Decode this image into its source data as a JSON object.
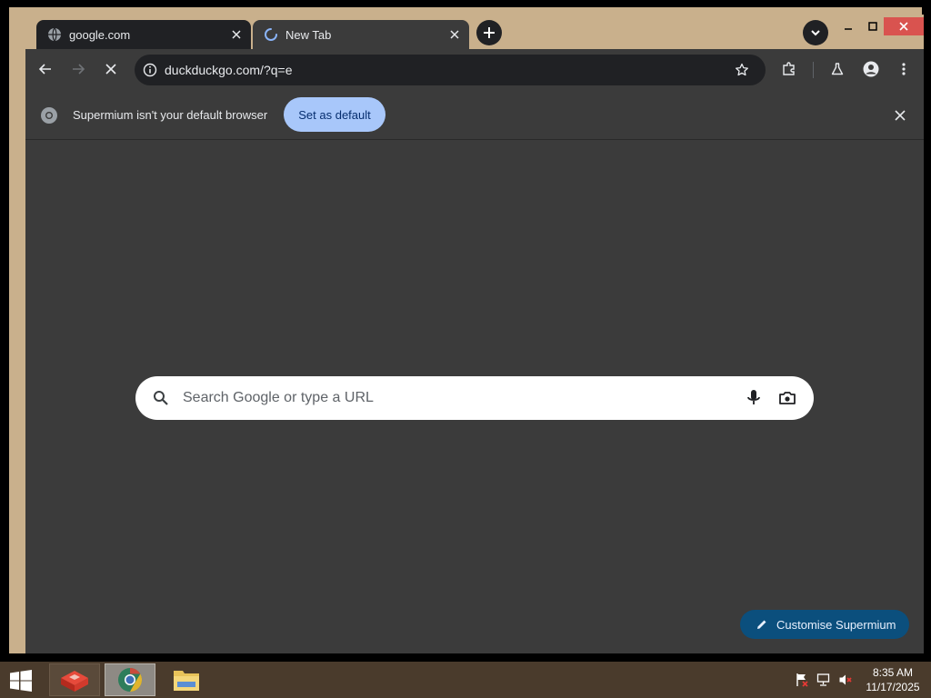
{
  "tabs": [
    {
      "title": "google.com",
      "favicon": "globe-icon"
    },
    {
      "title": "New Tab",
      "favicon": "loading-spinner-icon"
    }
  ],
  "toolbar": {
    "url": "duckduckgo.com/?q=e"
  },
  "infobar": {
    "message": "Supermium isn't your default browser",
    "button_label": "Set as default"
  },
  "search": {
    "placeholder": "Search Google or type a URL"
  },
  "customise": {
    "label": "Customise Supermium"
  },
  "taskbar": {
    "time": "8:35 AM",
    "date": "11/17/2025"
  },
  "colors": {
    "frame": "#c9b08c",
    "browser_bg": "#3b3b3b",
    "active_tab": "#202124",
    "set_default_button": "#a8c7fa",
    "customise_button": "#0b4f7d",
    "taskbar": "#4a3b2c"
  }
}
